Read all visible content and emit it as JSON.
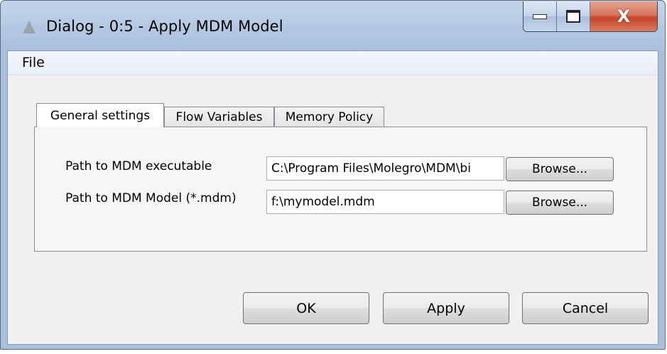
{
  "window": {
    "title": "Dialog - 0:5 - Apply MDM Model",
    "caption_buttons": {
      "minimize": "minimize-icon",
      "maximize": "maximize-icon",
      "close_glyph": "X"
    }
  },
  "menu": {
    "file": "File"
  },
  "tabs": [
    {
      "label": "General settings",
      "active": true
    },
    {
      "label": "Flow Variables",
      "active": false
    },
    {
      "label": "Memory Policy",
      "active": false
    }
  ],
  "settings": {
    "executable": {
      "label": "Path to MDM executable",
      "value": "C:\\Program Files\\Molegro\\MDM\\bi",
      "browse": "Browse..."
    },
    "model": {
      "label": "Path to MDM Model (*.mdm)",
      "value": "f:\\mymodel.mdm",
      "browse": "Browse..."
    }
  },
  "footer": {
    "ok": "OK",
    "apply": "Apply",
    "cancel": "Cancel"
  },
  "colors": {
    "titlebar": "#b2c8e2",
    "close_button": "#c7442a",
    "client_background": "#f0f0f0"
  }
}
